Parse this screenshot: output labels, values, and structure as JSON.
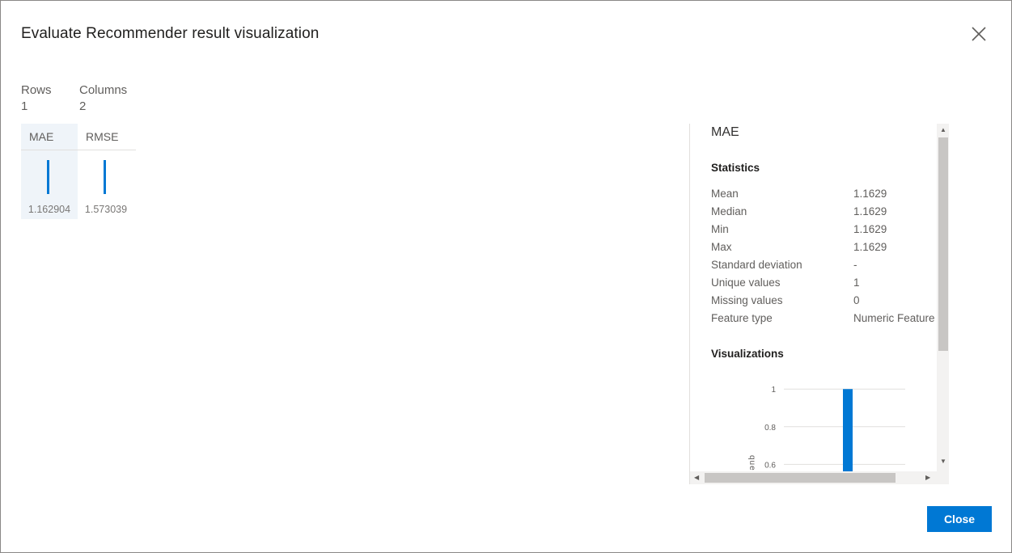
{
  "dialog": {
    "title": "Evaluate Recommender result visualization",
    "close_icon": "close-icon"
  },
  "summary": {
    "rows_label": "Rows",
    "rows_value": "1",
    "columns_label": "Columns",
    "columns_value": "2"
  },
  "columns": [
    {
      "name": "MAE",
      "value": "1.162904",
      "selected": true
    },
    {
      "name": "RMSE",
      "value": "1.573039",
      "selected": false
    }
  ],
  "side_panel": {
    "title": "MAE",
    "statistics_title": "Statistics",
    "statistics": [
      {
        "label": "Mean",
        "value": "1.1629"
      },
      {
        "label": "Median",
        "value": "1.1629"
      },
      {
        "label": "Min",
        "value": "1.1629"
      },
      {
        "label": "Max",
        "value": "1.1629"
      },
      {
        "label": "Standard deviation",
        "value": "-"
      },
      {
        "label": "Unique values",
        "value": "1"
      },
      {
        "label": "Missing values",
        "value": "0"
      },
      {
        "label": "Feature type",
        "value": "Numeric Feature"
      }
    ],
    "visualizations_title": "Visualizations",
    "y_axis_label": "quency"
  },
  "chart_data": {
    "type": "bar",
    "ylabel": "quency",
    "y_ticks": [
      "1",
      "0.8",
      "0.6"
    ],
    "ylim": [
      0.55,
      1
    ],
    "values": [
      1
    ]
  },
  "footer": {
    "close_label": "Close"
  },
  "colors": {
    "accent": "#0078d4",
    "selected_bg": "#eff4f9"
  }
}
